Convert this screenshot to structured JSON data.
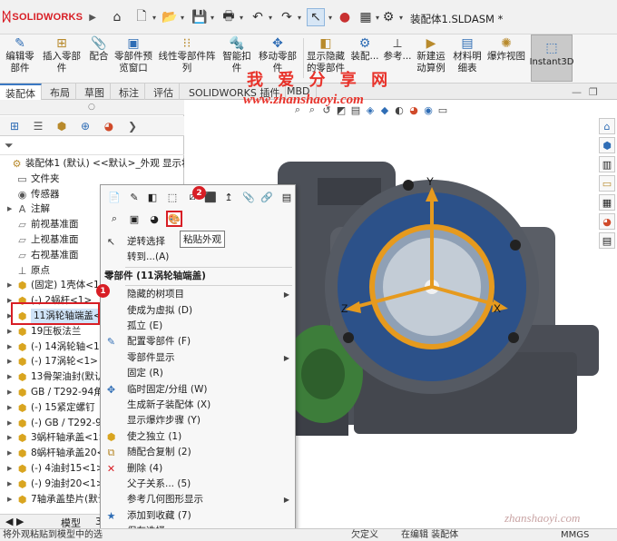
{
  "app": {
    "logo": "SOLIDWORKS",
    "title": "装配体1.SLDASM *"
  },
  "ribbon": [
    {
      "label": "编辑零\n部件",
      "icon": "edit-component-icon"
    },
    {
      "label": "插入零部件",
      "icon": "insert-components-icon"
    },
    {
      "label": "配合",
      "icon": "mate-icon"
    },
    {
      "label": "零部件预\n览窗口",
      "icon": "component-preview-icon"
    },
    {
      "label": "线性零部件阵列",
      "icon": "linear-pattern-icon"
    },
    {
      "label": "智能扣\n件",
      "icon": "smart-fasteners-icon"
    },
    {
      "label": "移动零部件",
      "icon": "move-component-icon"
    },
    {
      "label": "显示隐藏\n的零部件",
      "icon": "show-hidden-icon"
    },
    {
      "label": "装配...",
      "icon": "assembly-features-icon"
    },
    {
      "label": "参考...",
      "icon": "reference-geometry-icon"
    },
    {
      "label": "新建运\n动算例",
      "icon": "new-motion-study-icon"
    },
    {
      "label": "材料明\n细表",
      "icon": "bom-icon"
    },
    {
      "label": "爆炸视图",
      "icon": "exploded-view-icon"
    },
    {
      "label": "Instant3D",
      "icon": "instant3d-icon"
    }
  ],
  "tabs": [
    "装配体",
    "布局",
    "草图",
    "标注",
    "评估",
    "SOLIDWORKS 插件",
    "MBD"
  ],
  "watermark": {
    "text": "我 爱 分 享 网",
    "url": "www.zhanshaoyi.com",
    "url2": "zhanshaoyi.com"
  },
  "tree": [
    {
      "label": "装配体1 (默认) <<默认>_外观 显示状",
      "icon": "assembly-icon",
      "expandable": false
    },
    {
      "label": "文件夹",
      "icon": "folder-icon",
      "expandable": false
    },
    {
      "label": "传感器",
      "icon": "sensor-icon",
      "expandable": false
    },
    {
      "label": "注解",
      "icon": "annotation-icon",
      "expandable": true
    },
    {
      "label": "前视基准面",
      "icon": "plane-icon",
      "expandable": false
    },
    {
      "label": "上视基准面",
      "icon": "plane-icon",
      "expandable": false
    },
    {
      "label": "右视基准面",
      "icon": "plane-icon",
      "expandable": false
    },
    {
      "label": "原点",
      "icon": "origin-icon",
      "expandable": false
    },
    {
      "label": "(固定) 1壳体<1>",
      "icon": "part-icon",
      "expandable": true
    },
    {
      "label": "(-) 2蜗杆<1>",
      "icon": "part-icon",
      "expandable": true
    },
    {
      "label": "11涡轮轴端盖<1>",
      "icon": "part-icon",
      "expandable": true,
      "highlight": true
    },
    {
      "label": "19压板法兰",
      "icon": "part-icon",
      "expandable": true
    },
    {
      "label": "(-) 14涡轮轴<1>",
      "icon": "part-icon",
      "expandable": true
    },
    {
      "label": "(-) 17涡轮<1>",
      "icon": "part-icon",
      "expandable": true
    },
    {
      "label": "13骨架油封(默认)",
      "icon": "part-icon",
      "expandable": true
    },
    {
      "label": "GB / T292-94角",
      "icon": "part-icon",
      "expandable": true
    },
    {
      "label": "(-) 15紧定螺钉",
      "icon": "part-icon",
      "expandable": true
    },
    {
      "label": "(-) GB / T292-9",
      "icon": "part-icon",
      "expandable": true
    },
    {
      "label": "3蜗杆轴承盖<1>",
      "icon": "part-icon",
      "expandable": true
    },
    {
      "label": "8蜗杆轴承盖20<",
      "icon": "part-icon",
      "expandable": true
    },
    {
      "label": "(-) 4油封15<1>",
      "icon": "part-icon",
      "expandable": true
    },
    {
      "label": "(-) 9油封20<1>",
      "icon": "part-icon",
      "expandable": true
    },
    {
      "label": "7轴承盖垫片(默认",
      "icon": "part-icon",
      "expandable": true
    }
  ],
  "fm_bottom": {
    "model_tab": "模型",
    "tab3": "3"
  },
  "context_menu": {
    "tooltip": "粘贴外观",
    "items": [
      {
        "label": "逆转选择",
        "icon": "invert-selection-icon"
      },
      {
        "label": "转到...(A)",
        "icon": ""
      },
      {
        "label": "零部件 (11涡轮轴端盖)",
        "section": true
      },
      {
        "label": "隐藏的树项目",
        "icon": "",
        "submenu": true
      },
      {
        "label": "使成为虚拟 (D)",
        "icon": ""
      },
      {
        "label": "孤立 (E)",
        "icon": ""
      },
      {
        "label": "配置零部件 (F)",
        "icon": "configure-component-icon"
      },
      {
        "label": "零部件显示",
        "icon": "",
        "submenu": true
      },
      {
        "label": "固定 (R)",
        "icon": ""
      },
      {
        "label": "临时固定/分组 (W)",
        "icon": "temp-fix-icon"
      },
      {
        "label": "生成新子装配体 (X)",
        "icon": ""
      },
      {
        "label": "显示爆炸步骤 (Y)",
        "icon": ""
      },
      {
        "label": "使之独立 (1)",
        "icon": "make-independent-icon"
      },
      {
        "label": "随配合复制 (2)",
        "icon": "copy-with-mates-icon"
      },
      {
        "label": "删除 (4)",
        "icon": "delete-icon"
      },
      {
        "label": "父子关系... (5)",
        "icon": ""
      },
      {
        "label": "参考几何图形显示",
        "icon": "",
        "submenu": true
      },
      {
        "label": "添加到收藏 (7)",
        "icon": "add-favorite-icon"
      },
      {
        "label": "保存选择",
        "icon": "",
        "submenu": true
      }
    ]
  },
  "callouts": {
    "one": "1",
    "two": "2"
  },
  "axes": {
    "x": "X",
    "y": "Y",
    "z": "Z"
  },
  "status": {
    "left": "将外观粘贴到模型中的选",
    "underdefined": "欠定义",
    "editing": "在编辑 装配体",
    "units": "MMGS"
  },
  "colors": {
    "accent": "#3a78c3",
    "callout": "#d81e25",
    "watermark": "#e8322a",
    "highlight": "#cfe3f7"
  }
}
